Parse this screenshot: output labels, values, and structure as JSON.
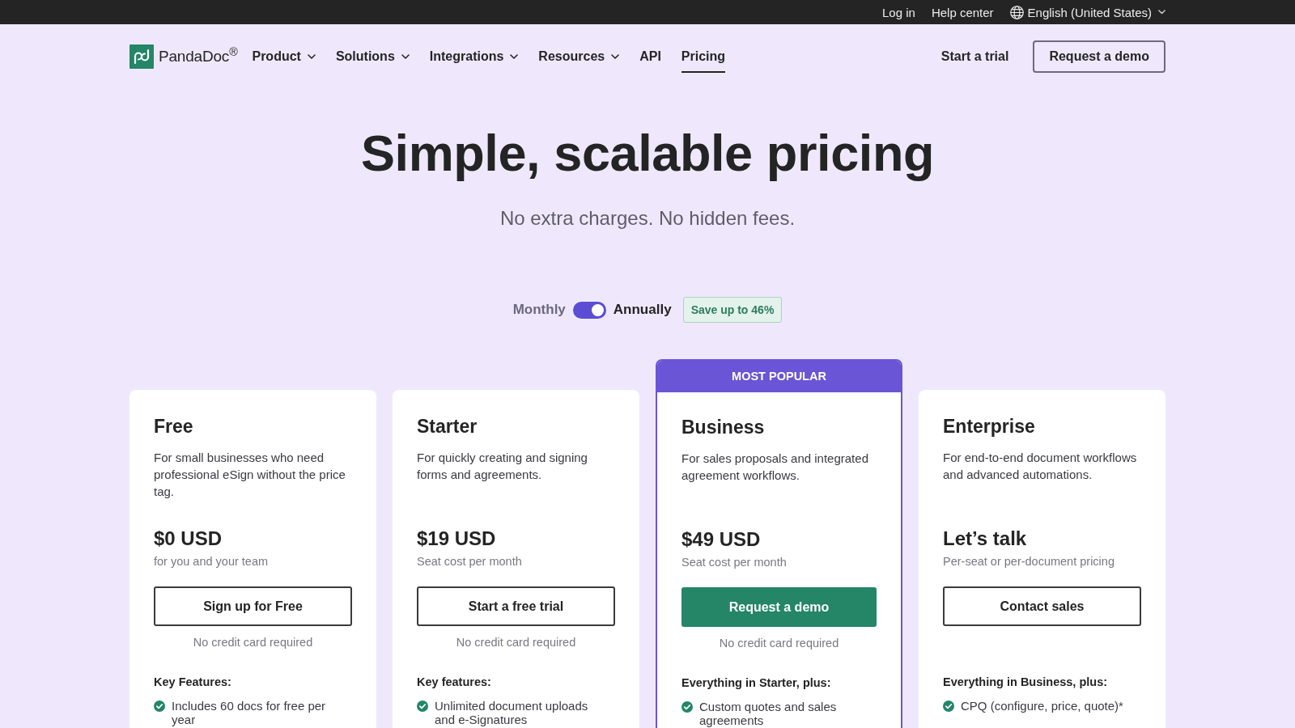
{
  "top_bar": {
    "links": [
      "Log in",
      "Help center"
    ],
    "language": "English (United States)"
  },
  "nav": {
    "logo": "PandaDoc$^{®}$",
    "items": [
      {
        "label": "Product",
        "dropdown": true,
        "selected": false
      },
      {
        "label": "Solutions",
        "dropdown": true,
        "selected": false
      },
      {
        "label": "Integrations",
        "dropdown": true,
        "selected": false
      },
      {
        "label": "Resources",
        "dropdown": true,
        "selected": false
      },
      {
        "label": "API",
        "dropdown": false,
        "selected": false
      },
      {
        "label": "Pricing",
        "dropdown": false,
        "selected": true
      }
    ],
    "start_trial": "Start a trial",
    "request_demo": "Request a demo"
  },
  "hero": {
    "title": "Simple, scalable pricing",
    "subtitle": "No extra charges. No hidden fees."
  },
  "billing": {
    "monthly_label": "Monthly",
    "annual_label": "Annually",
    "annual": true,
    "badge": "Save up to 46%"
  },
  "plans": [
    {
      "name": "Free",
      "description": "For small businesses who need professional eSign without the price tag.",
      "price": "$0 USD",
      "price_note": "for you and your team",
      "button": {
        "label": "Sign up for Free",
        "primary": false
      },
      "no_card_note": "No credit card required",
      "features_heading": "Key Features:",
      "features": [
        "Includes 60 docs for free per year"
      ]
    },
    {
      "name": "Starter",
      "description": "For quickly creating and signing forms and agreements.",
      "price": "$19 USD",
      "price_note": "Seat cost per month",
      "button": {
        "label": "Start a free trial",
        "primary": false
      },
      "no_card_note": "No credit card required",
      "features_heading": "Key features:",
      "features": [
        "Unlimited document uploads and e-Signatures"
      ]
    },
    {
      "badge": "MOST POPULAR",
      "name": "Business",
      "description": "For sales proposals and integrated agreement workflows.",
      "price": "$49 USD",
      "price_note": "Seat cost per month",
      "button": {
        "label": "Request a demo",
        "primary": true
      },
      "no_card_note": "No credit card required",
      "features_heading": "Everything in Starter, plus:",
      "features": [
        "Custom quotes and sales agreements"
      ]
    },
    {
      "name": "Enterprise",
      "description": "For end-to-end document workflows and advanced automations.",
      "price": "Let’s talk",
      "price_note": "Per-seat or per-document pricing",
      "button": {
        "label": "Contact sales",
        "primary": false
      },
      "features_heading": "Everything in Business, plus:",
      "features": [
        "CPQ (configure, price, quote)*"
      ]
    }
  ]
}
